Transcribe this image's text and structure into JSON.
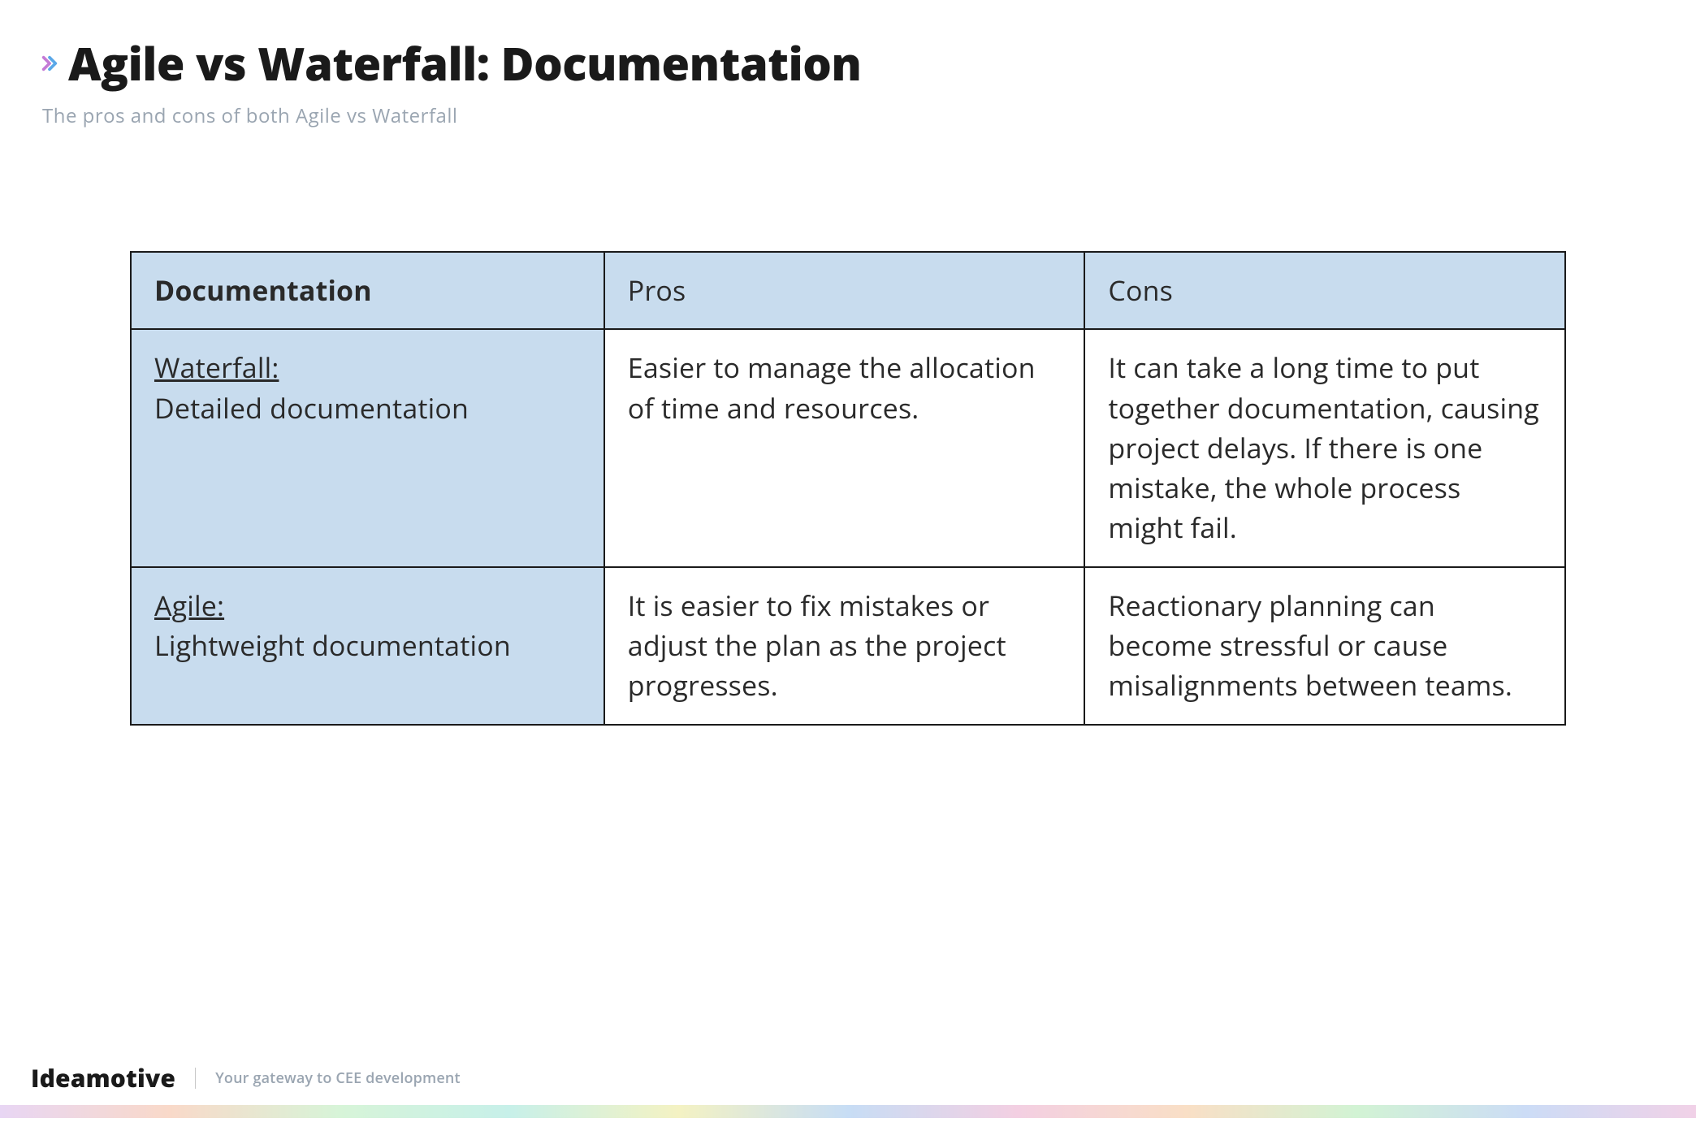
{
  "header": {
    "title": "Agile vs Waterfall: Documentation",
    "subtitle": "The pros and cons of both Agile vs Waterfall"
  },
  "table": {
    "columns": {
      "documentation": "Documentation",
      "pros": "Pros",
      "cons": "Cons"
    },
    "rows": [
      {
        "label_title": "Waterfall:",
        "label_desc": "Detailed documentation",
        "pros": "Easier to manage the allocation of time and resources.",
        "cons": "It can take a long time to put together documentation, causing project delays. If there is one mistake, the whole process might fail."
      },
      {
        "label_title": "Agile:",
        "label_desc": "Lightweight documentation",
        "pros": "It is easier to fix mistakes or adjust the plan as the project progresses.",
        "cons": "Reactionary planning can become stressful or cause misalignments between teams."
      }
    ]
  },
  "footer": {
    "brand": "Ideamotive",
    "tagline": "Your gateway to CEE development"
  }
}
